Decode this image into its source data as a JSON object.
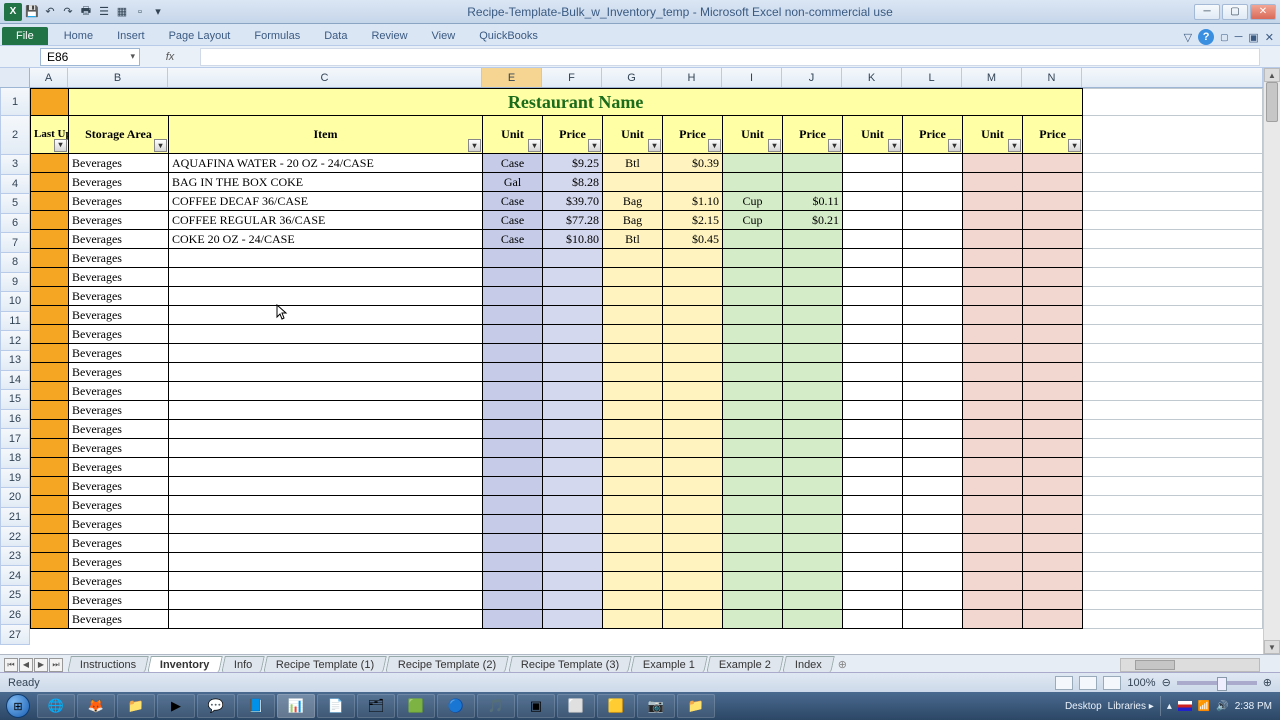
{
  "window": {
    "title": "Recipe-Template-Bulk_w_Inventory_temp - Microsoft Excel non-commercial use"
  },
  "ribbon": {
    "file": "File",
    "tabs": [
      "Home",
      "Insert",
      "Page Layout",
      "Formulas",
      "Data",
      "Review",
      "View",
      "QuickBooks"
    ]
  },
  "namebox": "E86",
  "fx": "fx",
  "columns": [
    "A",
    "B",
    "C",
    "E",
    "F",
    "G",
    "H",
    "I",
    "J",
    "K",
    "L",
    "M",
    "N"
  ],
  "selected_col": "E",
  "sheet": {
    "title": "Restaurant Name",
    "headers": {
      "last_update": "Last Update",
      "storage_area": "Storage Area",
      "item": "Item",
      "unit": "Unit",
      "price": "Price"
    },
    "rows": [
      {
        "n": 3,
        "area": "Beverages",
        "item": "AQUAFINA WATER - 20 OZ - 24/CASE",
        "u1": "Case",
        "p1": "$9.25",
        "u2": "Btl",
        "p2": "$0.39",
        "u3": "",
        "p3": "",
        "u4": "",
        "p4": "",
        "u5": "",
        "p5": ""
      },
      {
        "n": 4,
        "area": "Beverages",
        "item": "BAG IN THE BOX COKE",
        "u1": "Gal",
        "p1": "$8.28",
        "u2": "",
        "p2": "",
        "u3": "",
        "p3": "",
        "u4": "",
        "p4": "",
        "u5": "",
        "p5": ""
      },
      {
        "n": 5,
        "area": "Beverages",
        "item": "COFFEE DECAF 36/CASE",
        "u1": "Case",
        "p1": "$39.70",
        "u2": "Bag",
        "p2": "$1.10",
        "u3": "Cup",
        "p3": "$0.11",
        "u4": "",
        "p4": "",
        "u5": "",
        "p5": ""
      },
      {
        "n": 6,
        "area": "Beverages",
        "item": "COFFEE REGULAR 36/CASE",
        "u1": "Case",
        "p1": "$77.28",
        "u2": "Bag",
        "p2": "$2.15",
        "u3": "Cup",
        "p3": "$0.21",
        "u4": "",
        "p4": "",
        "u5": "",
        "p5": ""
      },
      {
        "n": 7,
        "area": "Beverages",
        "item": "COKE 20 OZ - 24/CASE",
        "u1": "Case",
        "p1": "$10.80",
        "u2": "Btl",
        "p2": "$0.45",
        "u3": "",
        "p3": "",
        "u4": "",
        "p4": "",
        "u5": "",
        "p5": ""
      },
      {
        "n": 8,
        "area": "Beverages"
      },
      {
        "n": 9,
        "area": "Beverages"
      },
      {
        "n": 10,
        "area": "Beverages"
      },
      {
        "n": 11,
        "area": "Beverages"
      },
      {
        "n": 12,
        "area": "Beverages"
      },
      {
        "n": 13,
        "area": "Beverages"
      },
      {
        "n": 14,
        "area": "Beverages"
      },
      {
        "n": 15,
        "area": "Beverages"
      },
      {
        "n": 16,
        "area": "Beverages"
      },
      {
        "n": 17,
        "area": "Beverages"
      },
      {
        "n": 18,
        "area": "Beverages"
      },
      {
        "n": 19,
        "area": "Beverages"
      },
      {
        "n": 20,
        "area": "Beverages"
      },
      {
        "n": 21,
        "area": "Beverages"
      },
      {
        "n": 22,
        "area": "Beverages"
      },
      {
        "n": 23,
        "area": "Beverages"
      },
      {
        "n": 24,
        "area": "Beverages"
      },
      {
        "n": 25,
        "area": "Beverages"
      },
      {
        "n": 26,
        "area": "Beverages"
      },
      {
        "n": 27,
        "area": "Beverages"
      }
    ]
  },
  "tabs": [
    "Instructions",
    "Inventory",
    "Info",
    "Recipe Template (1)",
    "Recipe Template (2)",
    "Recipe Template (3)",
    "Example 1",
    "Example 2",
    "Index"
  ],
  "active_tab": "Inventory",
  "status": {
    "ready": "Ready",
    "zoom": "100%"
  },
  "tray": {
    "desktop": "Desktop",
    "libraries": "Libraries",
    "time": "2:38 PM"
  }
}
